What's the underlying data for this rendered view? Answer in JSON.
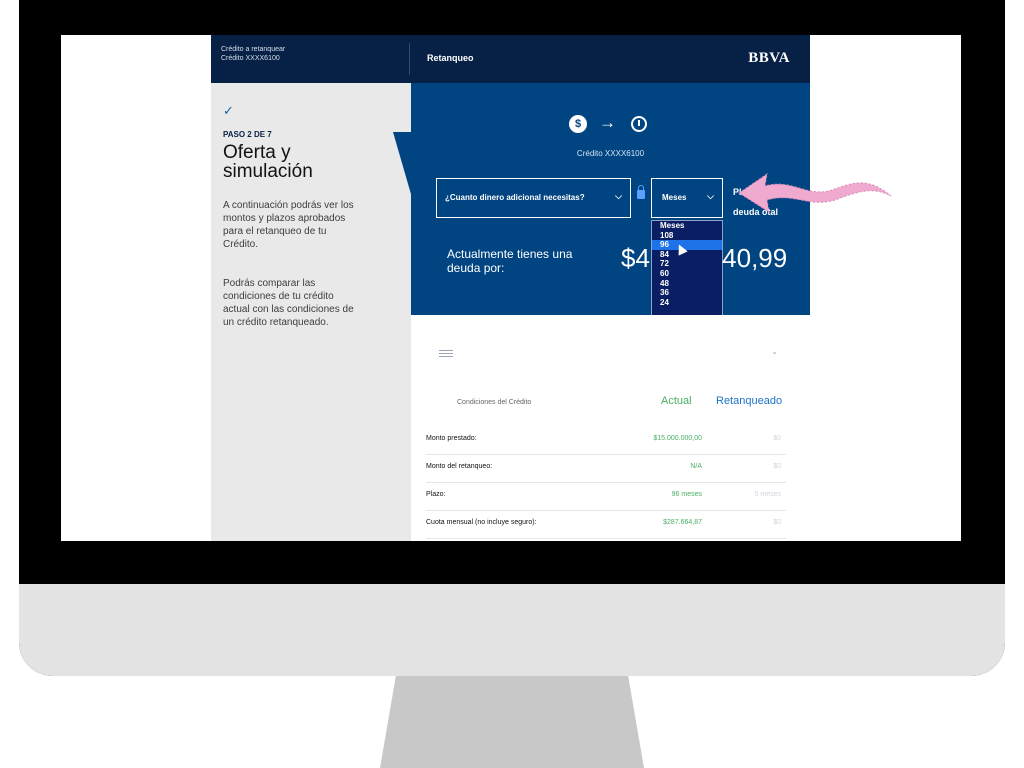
{
  "header": {
    "credit_title": "Crédito a retanquear",
    "credit_number": "Crédito XXXX6100",
    "section": "Retanqueo",
    "logo": "BBVA"
  },
  "sidebar": {
    "step": "PASO 2 DE 7",
    "title": "Oferta y simulación",
    "description_1": "A continuación podrás ver los montos y plazos aprobados para el retanqueo de tu Crédito.",
    "description_2": "Podrás comparar las condiciones de tu crédito actual con las condiciones de un crédito retanqueado."
  },
  "hero": {
    "coin_symbol": "$",
    "credit_id": "Crédito XXXX6100",
    "amount_placeholder": "¿Cuanto dinero adicional necesitas?",
    "months_label": "Meses",
    "months_options": [
      "Meses",
      "108",
      "96",
      "84",
      "72",
      "60",
      "48",
      "36",
      "24"
    ],
    "selected_option": "96",
    "plazo_label": "Plaz  ra",
    "deuda_label": "deuda  otal",
    "debt_label": "Actualmente tienes una deuda por:",
    "debt_amount": "$4          40,99"
  },
  "table": {
    "header_label": "Condiciones del Crédito",
    "col_actual": "Actual",
    "col_retanqueado": "Retanqueado",
    "rows": [
      {
        "label": "Monto prestado:",
        "actual": "$15.000.000,00",
        "retanqueado": "$0"
      },
      {
        "label": "Monto del retanqueo:",
        "actual": "N/A",
        "retanqueado": "$0"
      },
      {
        "label": "Plazo:",
        "actual": "96 meses",
        "retanqueado": "0 meses"
      },
      {
        "label": "Cuota mensual (no incluye seguro):",
        "actual": "$287.664,87",
        "retanqueado": "$0"
      }
    ]
  },
  "colors": {
    "navy": "#072146",
    "bbva_blue": "#004481",
    "highlight_blue": "#1e73e8",
    "green": "#48ae64",
    "annotation_pink": "#f0a9cf"
  },
  "icons": [
    "check-icon",
    "dollar-coin-icon",
    "right-arrow-icon",
    "clock-icon",
    "chevron-down-icon",
    "lock-icon",
    "mouse-cursor-icon",
    "list-icon",
    "collapse-icon",
    "pink-arrow-annotation"
  ]
}
